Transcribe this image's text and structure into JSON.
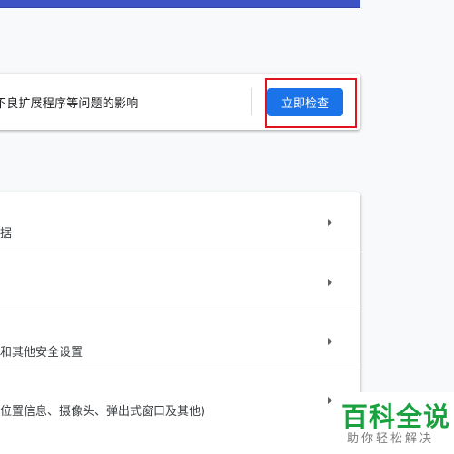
{
  "safety_check": {
    "description": "不良扩展程序等问题的影响",
    "button_label": "立即检查"
  },
  "privacy_rows": [
    {
      "label": "据"
    },
    {
      "label": ""
    },
    {
      "label": "和其他安全设置"
    },
    {
      "label": "位置信息、摄像头、弹出式窗口及其他)"
    }
  ],
  "watermark": {
    "title": "百科全说",
    "subtitle": "助你轻松解决"
  },
  "colors": {
    "accent": "#1a73e8",
    "highlight": "#e0141e",
    "watermark_green": "#1aa140"
  }
}
